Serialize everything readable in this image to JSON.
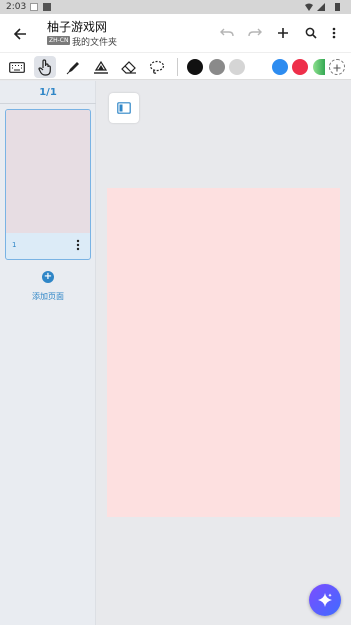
{
  "status_bar": {
    "time": "2:03"
  },
  "app_bar": {
    "title": "柚子游戏网",
    "lang_badge": "ZH-CN",
    "folder": "我的文件夹",
    "icons": [
      "back-arrow-icon",
      "undo-icon",
      "redo-icon",
      "add-icon",
      "search-icon",
      "more-vert-icon"
    ]
  },
  "toolbar": {
    "tools": [
      "keyboard-icon",
      "hand-pointer-icon",
      "pen-icon",
      "highlighter-icon",
      "eraser-icon",
      "lasso-icon"
    ],
    "active_tool": "hand-pointer-icon",
    "colors": [
      "#111111",
      "#8a8a8a",
      "#d5d5d5",
      "#ffffff",
      "#2d8cf0",
      "#ee2f4a"
    ],
    "gradient_swatch": [
      "#8ee08e",
      "#34a853"
    ]
  },
  "sidebar": {
    "page_count": "1/1",
    "page_number": "1",
    "add_page_label": "添加页面"
  },
  "colors": {
    "accent": "#2f86c7",
    "page_background": "#fde0e0",
    "thumb_preview": "#e7dde3"
  }
}
